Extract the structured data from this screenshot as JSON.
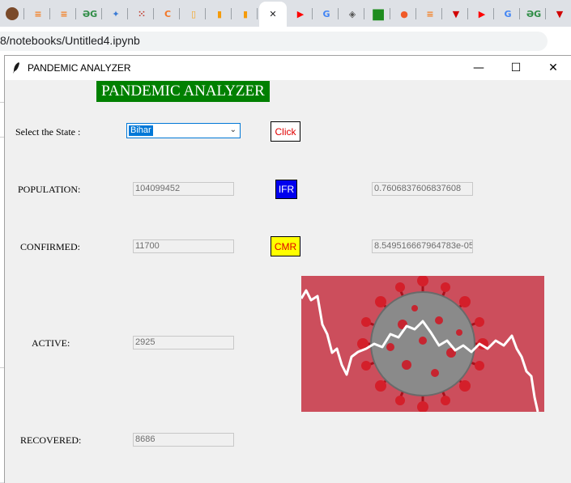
{
  "browser": {
    "address_url": "8/notebooks/Untitled4.ipynb",
    "tabs": [
      {
        "icon": "favicon-brown-icon",
        "glyph": "",
        "color": "#7a4a2a"
      },
      {
        "icon": "stackoverflow-icon",
        "glyph": "≡",
        "color": "#f48024"
      },
      {
        "icon": "stackoverflow-icon",
        "glyph": "≡",
        "color": "#f48024"
      },
      {
        "icon": "geeksforgeeks-icon",
        "glyph": "ƏG",
        "color": "#2f8d46"
      },
      {
        "icon": "colorful-app-icon",
        "glyph": "✦",
        "color": "#3a7bd5"
      },
      {
        "icon": "dice-icon",
        "glyph": "⁙",
        "color": "#c0392b"
      },
      {
        "icon": "orange-swirl-icon",
        "glyph": "C",
        "color": "#f37626"
      },
      {
        "icon": "document-icon",
        "glyph": "▯",
        "color": "#f5a623"
      },
      {
        "icon": "orange-book-icon",
        "glyph": "▮",
        "color": "#f59b0b"
      },
      {
        "icon": "orange-book-icon",
        "glyph": "▮",
        "color": "#f59b0b"
      },
      {
        "icon": "close-tab-icon",
        "glyph": "✕",
        "color": "#202124"
      },
      {
        "icon": "youtube-icon",
        "glyph": "▶",
        "color": "#ff0000"
      },
      {
        "icon": "google-icon",
        "glyph": "G",
        "color": "#4285f4"
      },
      {
        "icon": "diamond-icon",
        "glyph": "◈",
        "color": "#555555"
      },
      {
        "icon": "green-square-icon",
        "glyph": "■",
        "color": "#1e8c1e"
      },
      {
        "icon": "orange-circle-icon",
        "glyph": "●",
        "color": "#f05a28"
      },
      {
        "icon": "stackoverflow-icon",
        "glyph": "≡",
        "color": "#f48024"
      },
      {
        "icon": "red-v-icon",
        "glyph": "▼",
        "color": "#d10000"
      },
      {
        "icon": "youtube-icon",
        "glyph": "▶",
        "color": "#ff0000"
      },
      {
        "icon": "google-icon",
        "glyph": "G",
        "color": "#4285f4"
      },
      {
        "icon": "geeksforgeeks-icon",
        "glyph": "ƏG",
        "color": "#2f8d46"
      },
      {
        "icon": "red-v-icon",
        "glyph": "▼",
        "color": "#d10000"
      }
    ]
  },
  "window": {
    "title": "PANDEMIC ANALYZER",
    "controls": {
      "minimize": "—",
      "maximize": "☐",
      "close": "✕"
    }
  },
  "app": {
    "heading": "PANDEMIC ANALYZER",
    "state_label": "Select the State :",
    "state_value": "Bihar",
    "click_button": "Click",
    "population_label": "POPULATION:",
    "population_value": "104099452",
    "ifr_button": "IFR",
    "ifr_value": "0.7606837606837608",
    "confirmed_label": "CONFIRMED:",
    "confirmed_value": "11700",
    "cmr_button": "CMR",
    "cmr_value": "8.549516667964783e-05",
    "active_label": "ACTIVE:",
    "active_value": "2925",
    "recovered_label": "RECOVERED:",
    "recovered_value": "8686"
  },
  "colors": {
    "heading_bg": "#008000",
    "click_text": "#e00000",
    "ifr_bg": "#0000ee",
    "cmr_bg": "#ffff00",
    "virus_bg": "#cc4e5c"
  }
}
